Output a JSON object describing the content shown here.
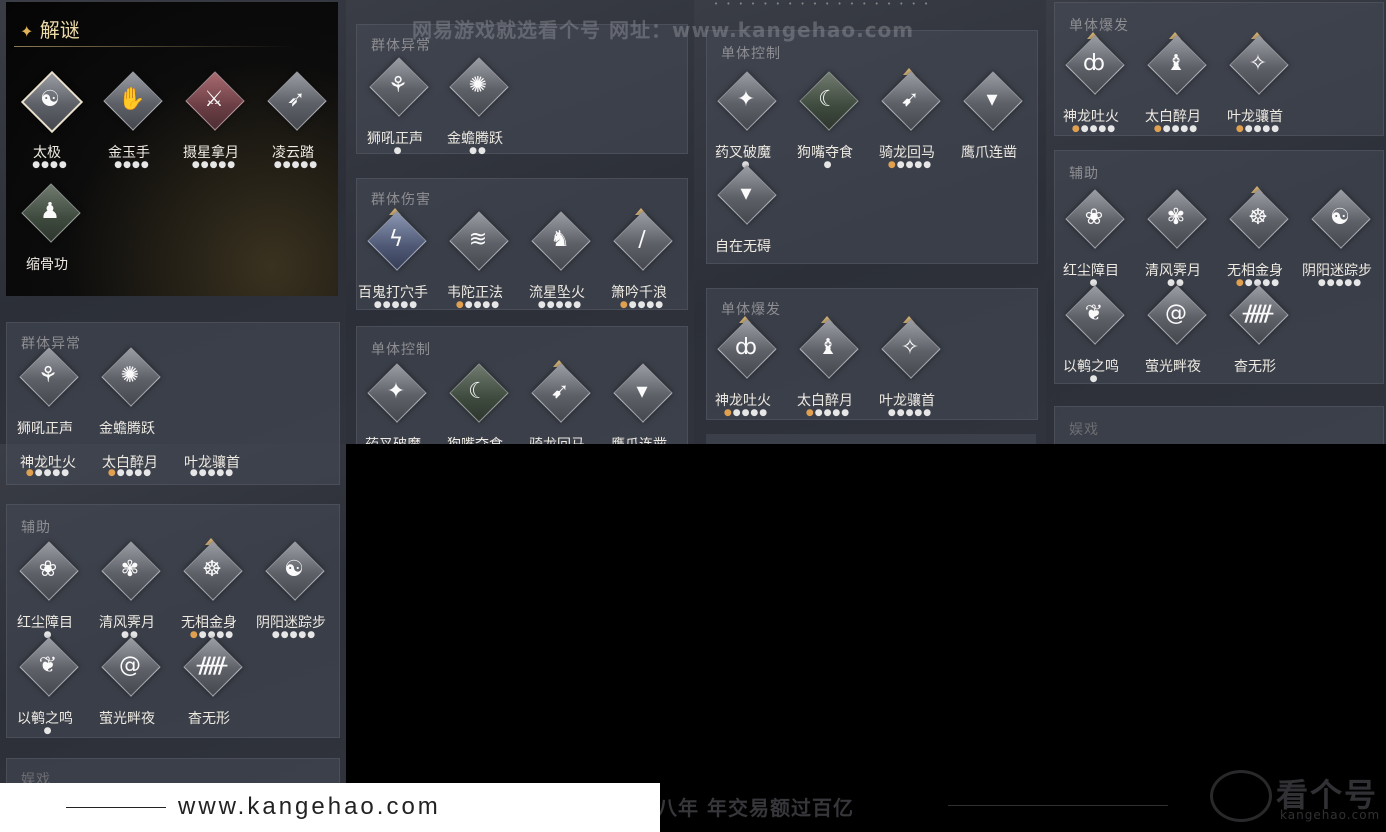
{
  "title": "解谜",
  "title_icon": "sparkle-icon",
  "watermark_top": "网易游戏就选看个号   网址：www.kangehao.com",
  "watermark_bottom": "看个号专业网易游戏八年   年交易额过百亿",
  "footer_url": "www.kangehao.com",
  "logo_text": "看个号",
  "logo_sub": "kangehao.com",
  "labels": {
    "qtyc": "群体异常",
    "qtsh": "群体伤害",
    "dtkz": "单体控制",
    "dtbf": "单体爆发",
    "fz": "辅助",
    "mx": "娱戏"
  },
  "jiemi_skills": [
    "太极",
    "金玉手",
    "摄星拿月",
    "凌云踏",
    "缩骨功"
  ],
  "qtyc_skills": [
    "狮吼正声",
    "金蟾腾跃"
  ],
  "qtsh_skills": [
    "百鬼打穴手",
    "韦陀正法",
    "流星坠火",
    "箫吟千浪"
  ],
  "dtkz_skills": [
    "药叉破魔",
    "狗嘴夺食",
    "骑龙回马",
    "鹰爪连凿",
    "自在无碍"
  ],
  "dtbf_skills": [
    "神龙吐火",
    "太白醉月",
    "叶龙骧首"
  ],
  "fz_skills": [
    "红尘障目",
    "清风霁月",
    "无相金身",
    "阴阳迷踪步",
    "以鹌之鸣",
    "萤光畔夜",
    "杳无形"
  ],
  "accent_colors": {
    "gold": "#d7b57a",
    "dot_orange": "#e0a050"
  }
}
